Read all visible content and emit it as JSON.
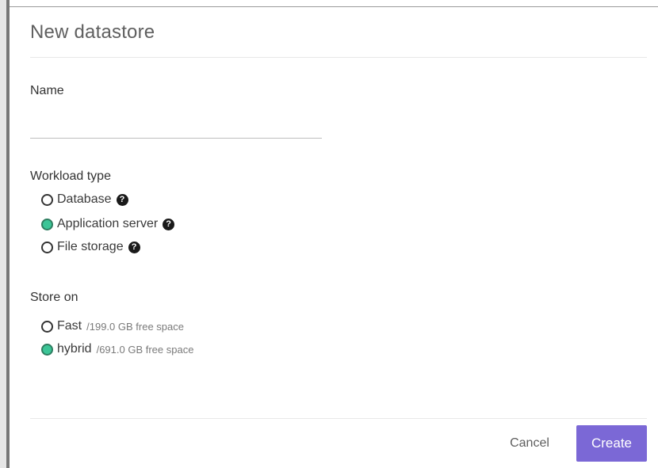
{
  "dialog": {
    "title": "New datastore"
  },
  "name_field": {
    "label": "Name",
    "value": "",
    "placeholder": ""
  },
  "workload": {
    "label": "Workload type",
    "selected": "Application server",
    "options": [
      {
        "label": "Database",
        "checked": false,
        "help_icon": "question-circle-icon"
      },
      {
        "label": "Application server",
        "checked": true,
        "help_icon": "question-circle-icon"
      },
      {
        "label": "File storage",
        "checked": false,
        "help_icon": "question-circle-icon"
      }
    ]
  },
  "store": {
    "label": "Store on",
    "selected": "hybrid",
    "options": [
      {
        "label": "Fast",
        "space": "/199.0 GB free space",
        "checked": false
      },
      {
        "label": "hybrid",
        "space": "/691.0 GB free space",
        "checked": true
      }
    ]
  },
  "footer": {
    "cancel_label": "Cancel",
    "create_label": "Create"
  },
  "colors": {
    "primary_button": "#7b68d6",
    "radio_checked": "#3cc597",
    "help_icon": "#1a1a1a"
  }
}
